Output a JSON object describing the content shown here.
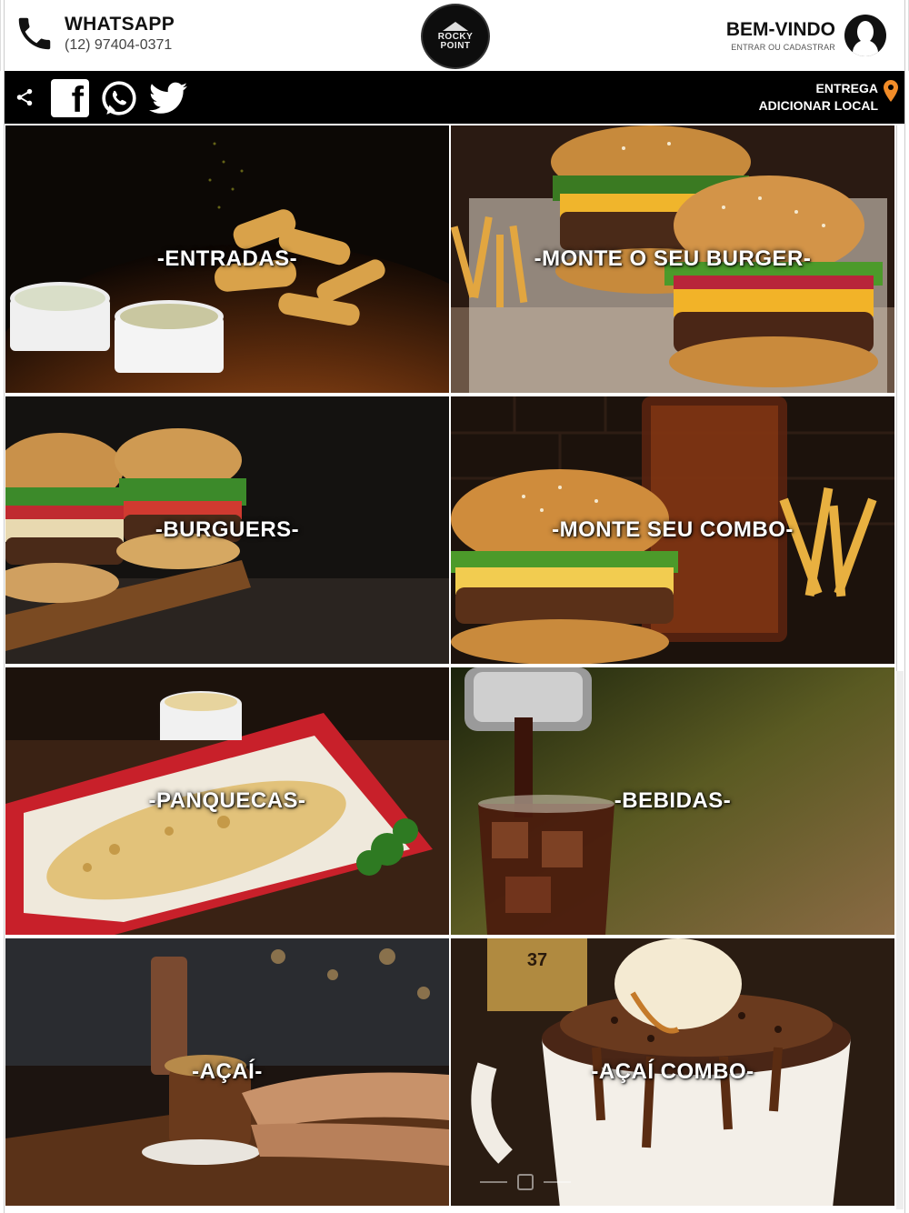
{
  "header": {
    "whatsapp_title": "WHATSAPP",
    "whatsapp_number": "(12) 97404-0371",
    "logo_text": "ROCKY POINT",
    "welcome_title": "BEM-VINDO",
    "welcome_sub": "ENTRAR OU CADASTRAR"
  },
  "navbar": {
    "social_icons": [
      "share-icon",
      "facebook-icon",
      "whatsapp-icon",
      "twitter-icon"
    ],
    "delivery_label": "ENTREGA",
    "delivery_action": "ADICIONAR LOCAL",
    "pin_color": "#f28c28"
  },
  "categories": [
    {
      "label": "-ENTRADAS-"
    },
    {
      "label": "-MONTE O SEU BURGER-"
    },
    {
      "label": "-BURGUERS-"
    },
    {
      "label": "-MONTE SEU COMBO-"
    },
    {
      "label": "-PANQUECAS-"
    },
    {
      "label": "-BEBIDAS-"
    },
    {
      "label": "-AÇAÍ-"
    },
    {
      "label": "-AÇAÍ COMBO-"
    }
  ],
  "colors": {
    "header_bg": "#ffffff",
    "navbar_bg": "#000000",
    "label_text": "#ffffff",
    "accent_red": "#c8202a"
  }
}
